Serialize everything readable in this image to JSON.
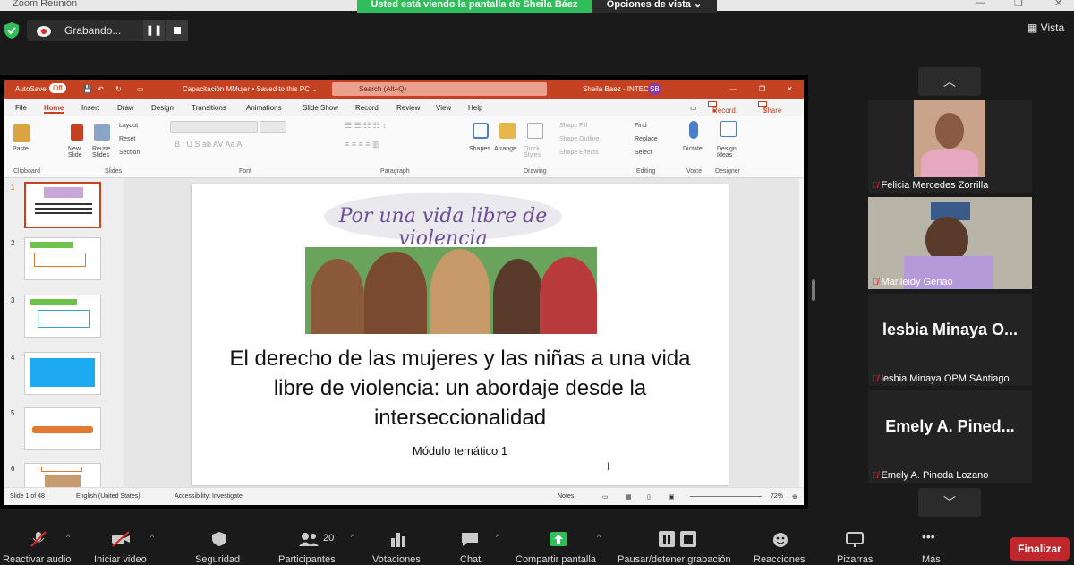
{
  "window": {
    "title": "Zoom Reunión",
    "banner": "Usted está viendo la pantalla de Sheila Báez",
    "view_options": "Opciones de vista ⌄",
    "view_label": "Vista"
  },
  "recording": {
    "label": "Grabando...",
    "pause": "❚❚"
  },
  "ppt": {
    "autosave": "AutoSave",
    "autosave_state": "Off",
    "doc_title": "Capacitación MMujer • Saved to this PC ⌄",
    "search": "Search (Alt+Q)",
    "user": "Sheila Baez - INTEC",
    "user_initials": "SB",
    "tabs": [
      "File",
      "Home",
      "Insert",
      "Draw",
      "Design",
      "Transitions",
      "Animations",
      "Slide Show",
      "Record",
      "Review",
      "View",
      "Help"
    ],
    "record_btn": "Record",
    "share_btn": "Share",
    "ribbon": {
      "paste": "Paste",
      "new_slide": "New Slide",
      "reuse": "Reuse Slides",
      "layout": "Layout",
      "reset": "Reset",
      "section": "Section",
      "shapes": "Shapes",
      "arrange": "Arrange",
      "quick_styles": "Quick Styles",
      "shape_fill": "Shape Fill",
      "shape_outline": "Shape Outline",
      "shape_effects": "Shape Effects",
      "find": "Find",
      "replace": "Replace",
      "select": "Select",
      "dictate": "Dictate",
      "design_ideas": "Design Ideas",
      "groups": [
        "Clipboard",
        "Slides",
        "Font",
        "Paragraph",
        "Drawing",
        "Editing",
        "Voice",
        "Designer"
      ]
    },
    "thumbs": [
      "1",
      "2",
      "3",
      "4",
      "5",
      "6"
    ],
    "slide": {
      "banner": "Por una vida libre de violencia",
      "title": "El derecho de las mujeres y las niñas a una vida libre de violencia: un abordaje desde la interseccionalidad",
      "subtitle": "Módulo temático 1"
    },
    "status": {
      "slide": "Slide 1 of 48",
      "lang": "English (United States)",
      "accessibility": "Accessibility: Investigate",
      "notes": "Notes",
      "zoom": "72%"
    }
  },
  "participants": [
    {
      "name": "Felicia Mercedes Zorrilla",
      "video": true
    },
    {
      "name": "Marileidy Genao",
      "video": true
    },
    {
      "name": "lesbia Minaya OPM SAntiago",
      "big": "lesbia Minaya O...",
      "video": false
    },
    {
      "name": "Emely A. Pineda Lozano",
      "big": "Emely A. Pined...",
      "video": false
    }
  ],
  "toolbar": {
    "mute": "Reactivar audio",
    "video": "Iniciar video",
    "security": "Seguridad",
    "participants": "Participantes",
    "participants_count": "20",
    "polls": "Votaciones",
    "chat": "Chat",
    "share": "Compartir pantalla",
    "pause_rec": "Pausar/detener grabación",
    "reactions": "Reacciones",
    "whiteboards": "Pizarras",
    "more": "Más",
    "end": "Finalizar"
  },
  "colors": {
    "accent_green": "#2fbe5a",
    "ppt_red": "#c44121",
    "end_red": "#c0272d"
  }
}
